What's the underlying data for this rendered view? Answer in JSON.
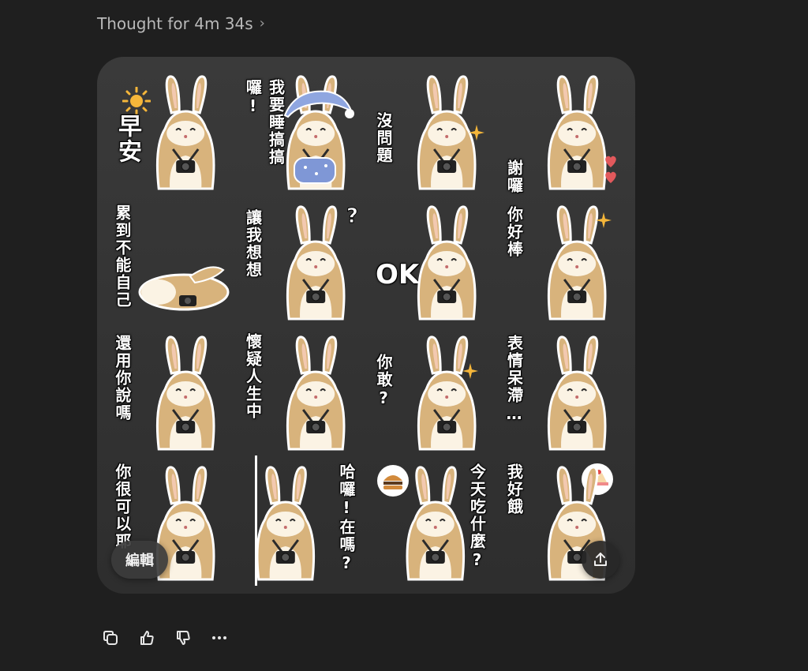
{
  "header": {
    "thought_label": "Thought for 4m 34s",
    "chevron": "›"
  },
  "stickers": [
    {
      "caption": "早安"
    },
    {
      "caption": "我要睡搞搞囉!"
    },
    {
      "caption": "沒問題"
    },
    {
      "caption": "謝囉"
    },
    {
      "caption": "累到不能自己"
    },
    {
      "caption": "讓我想想"
    },
    {
      "caption": "OK"
    },
    {
      "caption": "你好棒"
    },
    {
      "caption": "還用你說嗎"
    },
    {
      "caption": "懷疑人生中"
    },
    {
      "caption": "你敢?"
    },
    {
      "caption": "表情呆滯…"
    },
    {
      "caption": "你很可以耶"
    },
    {
      "caption": "哈囉!在嗎?"
    },
    {
      "caption": "今天吃什麼?"
    },
    {
      "caption": "我好餓"
    }
  ],
  "card": {
    "edit_label": "編輯"
  },
  "colors": {
    "background": "#1f1f1f",
    "card": "#363636",
    "bunny": "#d8b37c",
    "cream": "#fbf3e4"
  },
  "icons": [
    "chevron-right-icon",
    "share-upload-icon",
    "copy-icon",
    "thumbs-up-icon",
    "thumbs-down-icon",
    "more-icon"
  ]
}
